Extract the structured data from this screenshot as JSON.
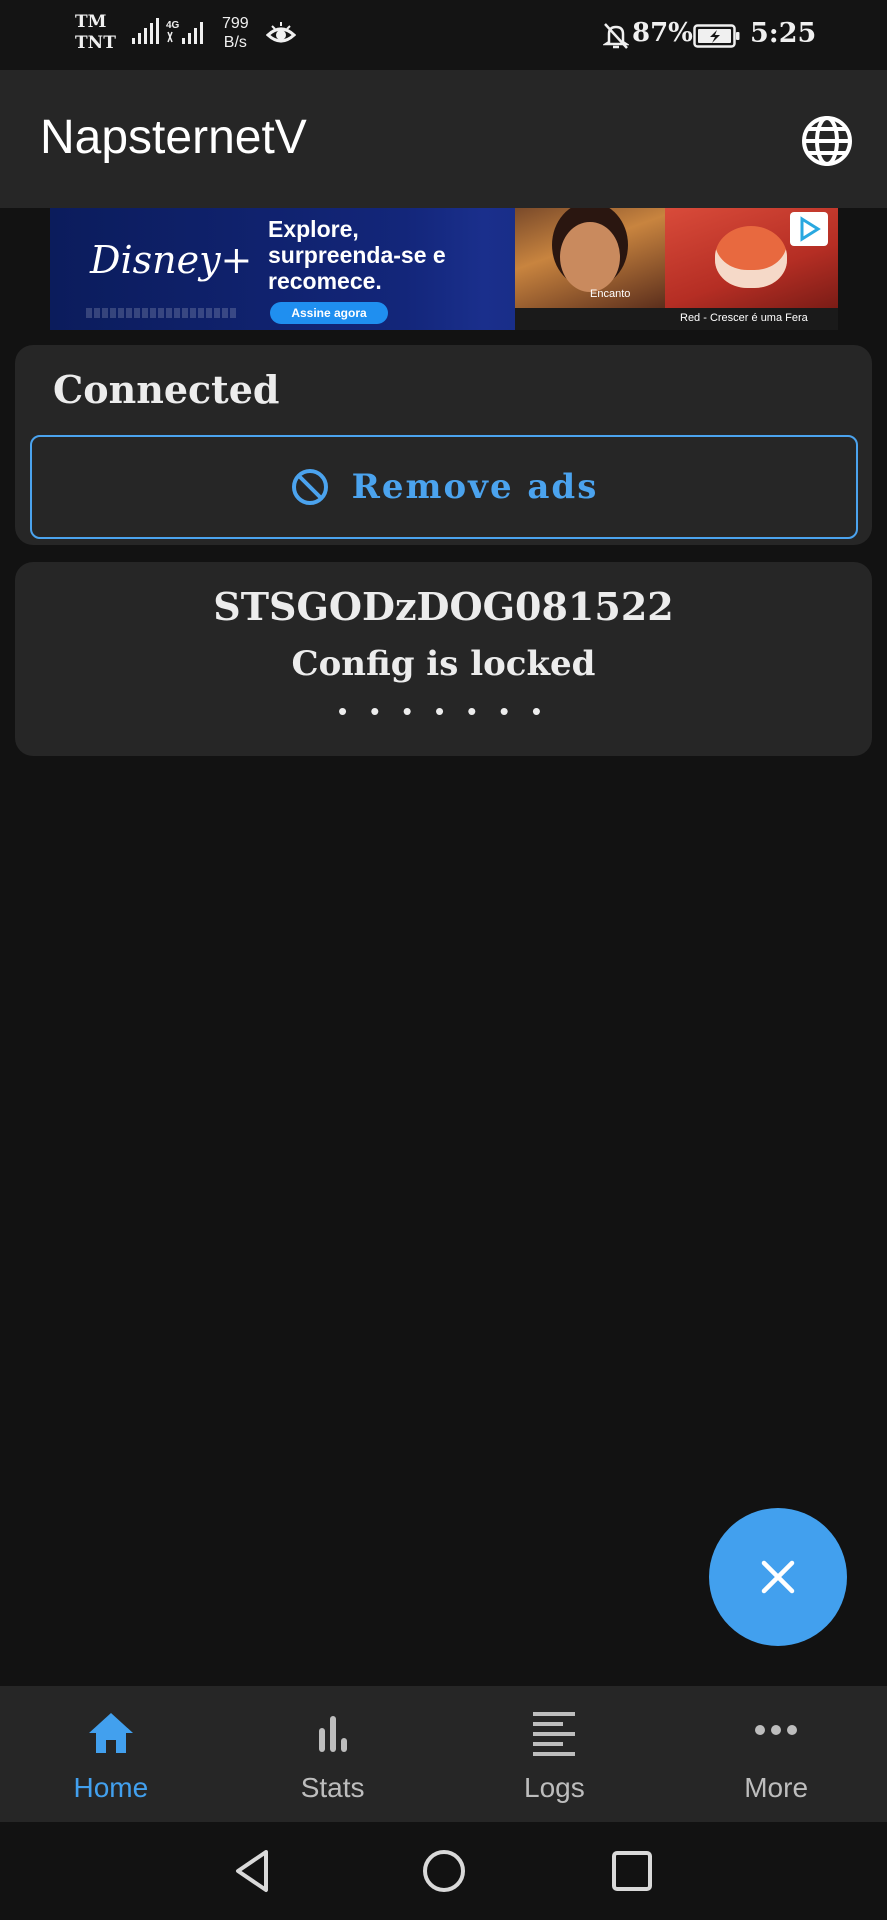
{
  "status_bar": {
    "carrier_1": "TM",
    "carrier_2": "TNT",
    "net_speed_value": "799",
    "net_speed_unit": "B/s",
    "battery_percent": "87%",
    "time": "5:25"
  },
  "app_bar": {
    "title": "NapsternetV",
    "action_icon": "globe-icon"
  },
  "ad": {
    "brand": "Disney+",
    "headline_1": "Explore,",
    "headline_2": "surpreenda-se e",
    "headline_3": "recomece.",
    "cta": "Assine agora",
    "caption_1": "Encanto",
    "caption_2": "Red - Crescer é uma Fera"
  },
  "connection": {
    "status": "Connected",
    "remove_ads_label": "Remove ads",
    "remove_ads_icon": "block-icon"
  },
  "config": {
    "name": "STSGODzDOG081522",
    "status": "Config is locked",
    "masked": "• • • • • • •"
  },
  "fab": {
    "icon": "close-icon"
  },
  "bottom_nav": {
    "items": [
      {
        "label": "Home",
        "icon": "home-icon",
        "active": true
      },
      {
        "label": "Stats",
        "icon": "bar-chart-icon",
        "active": false
      },
      {
        "label": "Logs",
        "icon": "list-icon",
        "active": false
      },
      {
        "label": "More",
        "icon": "more-horizontal-icon",
        "active": false
      }
    ]
  },
  "colors": {
    "accent": "#42a0ee",
    "background": "#121212",
    "surface": "#262626",
    "text": "#ececec",
    "inactive": "#bdbdbd"
  }
}
